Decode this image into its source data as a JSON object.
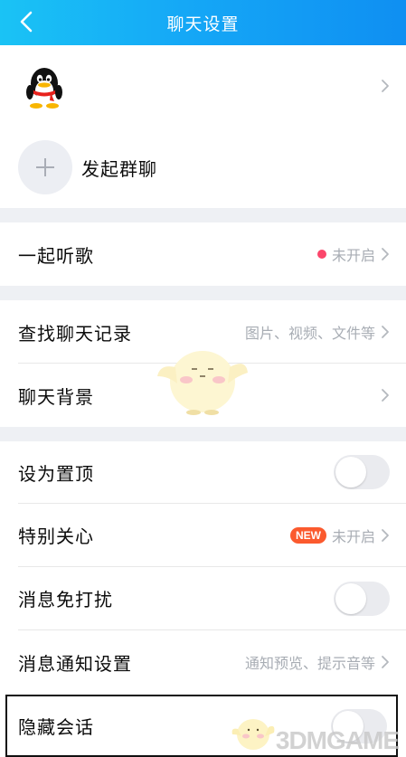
{
  "header": {
    "title": "聊天设置"
  },
  "profile": {
    "avatar_icon": "qq-penguin-icon",
    "start_group_label": "发起群聊"
  },
  "listen_together": {
    "label": "一起听歌",
    "status": "未开启",
    "status_dot_color": "#fb466b"
  },
  "history": {
    "search_label": "查找聊天记录",
    "search_hint": "图片、视频、文件等",
    "background_label": "聊天背景"
  },
  "settings": {
    "pin_label": "设为置顶",
    "special_care_label": "特别关心",
    "special_care_badge": "NEW",
    "special_care_status": "未开启",
    "dnd_label": "消息免打扰",
    "notify_label": "消息通知设置",
    "notify_hint": "通知预览、提示音等",
    "hide_label": "隐藏会话"
  },
  "toggles": {
    "pin": false,
    "dnd": false,
    "hide": false
  },
  "watermark": {
    "text": "3DMGAME"
  },
  "colors": {
    "accent": "#12a6f5",
    "badge": "#fb5a2e",
    "text_secondary": "#a8adb4"
  }
}
